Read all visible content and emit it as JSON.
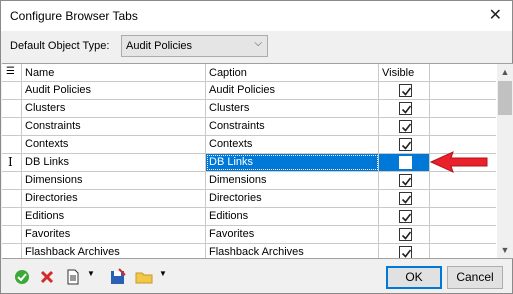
{
  "window": {
    "title": "Configure Browser Tabs",
    "close_glyph": "✕"
  },
  "object_type": {
    "label": "Default Object Type:",
    "selected": "Audit Policies",
    "arrow_glyph": "⌵"
  },
  "grid": {
    "headers": {
      "name": "Name",
      "caption": "Caption",
      "visible": "Visible"
    },
    "rows": [
      {
        "name": "Audit Policies",
        "caption": "Audit Policies",
        "visible": true,
        "selected": false,
        "cursor": ""
      },
      {
        "name": "Clusters",
        "caption": "Clusters",
        "visible": true,
        "selected": false,
        "cursor": ""
      },
      {
        "name": "Constraints",
        "caption": "Constraints",
        "visible": true,
        "selected": false,
        "cursor": ""
      },
      {
        "name": "Contexts",
        "caption": "Contexts",
        "visible": true,
        "selected": false,
        "cursor": ""
      },
      {
        "name": "DB Links",
        "caption": "DB Links",
        "visible": false,
        "selected": true,
        "cursor": "I"
      },
      {
        "name": "Dimensions",
        "caption": "Dimensions",
        "visible": true,
        "selected": false,
        "cursor": ""
      },
      {
        "name": "Directories",
        "caption": "Directories",
        "visible": true,
        "selected": false,
        "cursor": ""
      },
      {
        "name": "Editions",
        "caption": "Editions",
        "visible": true,
        "selected": false,
        "cursor": ""
      },
      {
        "name": "Favorites",
        "caption": "Favorites",
        "visible": true,
        "selected": false,
        "cursor": ""
      },
      {
        "name": "Flashback Archives",
        "caption": "Flashback Archives",
        "visible": true,
        "selected": false,
        "cursor": ""
      }
    ]
  },
  "toolbar": {
    "icons": [
      "check-circle-icon",
      "red-x-icon",
      "document-icon",
      "dropdown-icon",
      "save-icon",
      "folder-icon",
      "dropdown-icon"
    ]
  },
  "buttons": {
    "ok": "OK",
    "cancel": "Cancel"
  },
  "colors": {
    "selection": "#0078d7",
    "annotation_arrow": "#e8212a",
    "ok_border": "#0078d7"
  }
}
